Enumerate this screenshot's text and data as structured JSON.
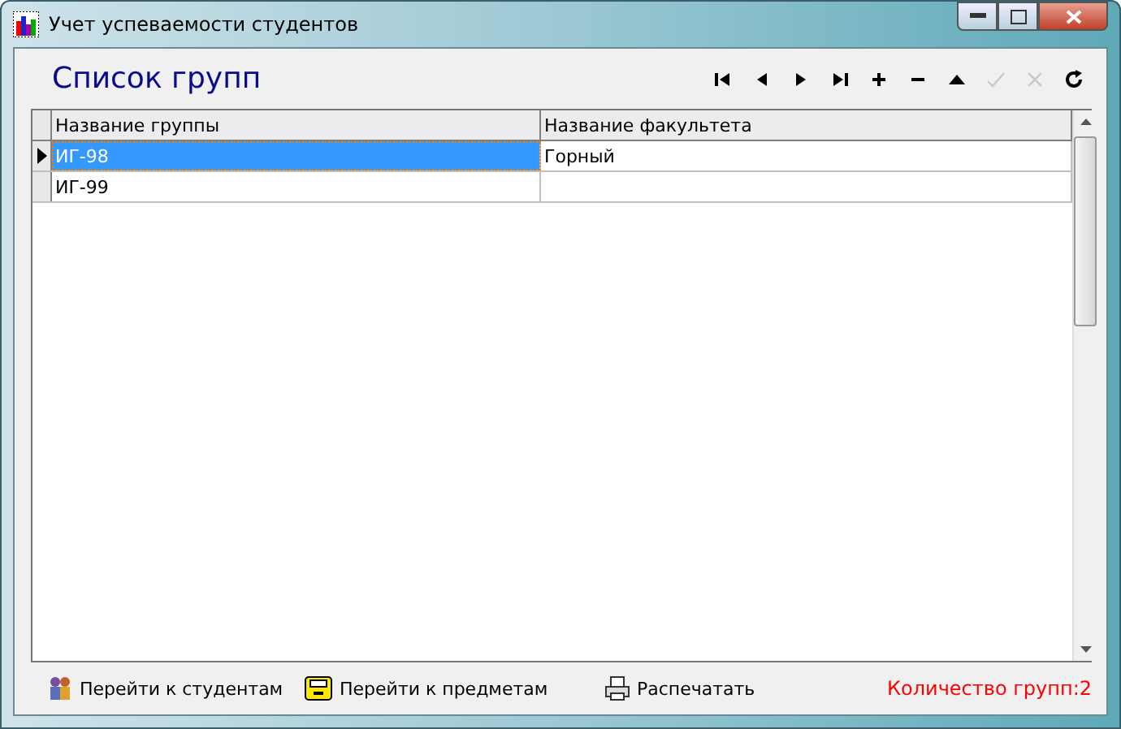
{
  "window": {
    "title": "Учет успеваемости студентов"
  },
  "heading": "Список групп",
  "navigator": [
    {
      "kind": "first",
      "disabled": false
    },
    {
      "kind": "prior",
      "disabled": false
    },
    {
      "kind": "next",
      "disabled": false
    },
    {
      "kind": "last",
      "disabled": false
    },
    {
      "kind": "insert",
      "disabled": false
    },
    {
      "kind": "delete",
      "disabled": false
    },
    {
      "kind": "edit",
      "disabled": false
    },
    {
      "kind": "post",
      "disabled": true
    },
    {
      "kind": "cancel",
      "disabled": true
    },
    {
      "kind": "refresh",
      "disabled": false
    }
  ],
  "table": {
    "columns": [
      "Название группы",
      "Название факультета"
    ],
    "rows": [
      {
        "cells": [
          "ИГ-98",
          "Горный"
        ],
        "selected": true
      },
      {
        "cells": [
          "ИГ-99",
          ""
        ],
        "selected": false
      }
    ]
  },
  "footer": {
    "buttons": [
      {
        "kind": "students",
        "label": "Перейти к студентам"
      },
      {
        "kind": "subjects",
        "label": "Перейти к предметам"
      },
      {
        "kind": "print",
        "label": "Распечатать"
      }
    ],
    "count": "Количество групп:2"
  }
}
